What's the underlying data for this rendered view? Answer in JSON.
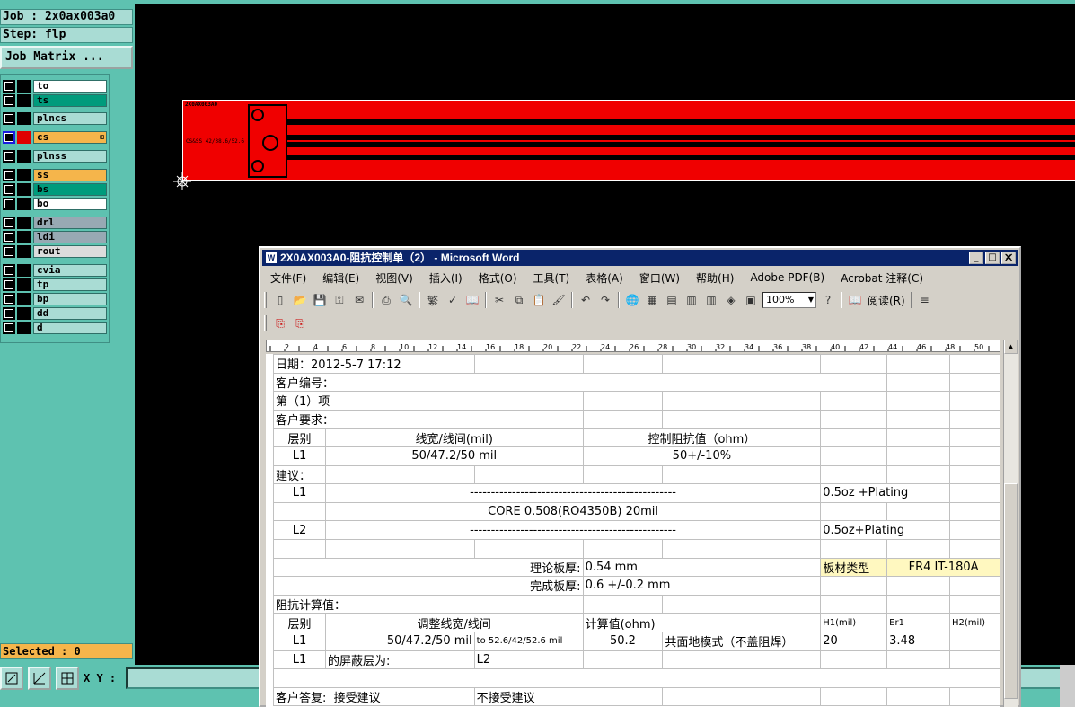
{
  "cam": {
    "job_line": "Job : 2x0ax003a0",
    "step_line": "Step: flp",
    "job_matrix_label": "Job Matrix ...",
    "selected_line": "Selected : 0",
    "xy_label": "X Y :",
    "xy_value": "",
    "layers": [
      {
        "name": "to",
        "color": "#ffffff"
      },
      {
        "name": "ts",
        "color": "#009b7c"
      },
      {
        "name": "plncs",
        "color": "#a9dcd4"
      },
      {
        "name": "cs",
        "color": "#f5b54b",
        "active": true
      },
      {
        "name": "plnss",
        "color": "#a9dcd4"
      },
      {
        "name": "ss",
        "color": "#f5b54b"
      },
      {
        "name": "bs",
        "color": "#009b7c"
      },
      {
        "name": "bo",
        "color": "#ffffff"
      },
      {
        "name": "drl",
        "color": "#97a9b3"
      },
      {
        "name": "ldi",
        "color": "#97a9b3"
      },
      {
        "name": "rout",
        "color": "#dcdcdc"
      },
      {
        "name": "cvia",
        "color": "#a9dcd4"
      },
      {
        "name": "tp",
        "color": "#a9dcd4"
      },
      {
        "name": "bp",
        "color": "#a9dcd4"
      },
      {
        "name": "dd",
        "color": "#a9dcd4"
      },
      {
        "name": "d",
        "color": "#a9dcd4"
      }
    ],
    "board_label_top": "2X0AX003A0",
    "board_label_side": "CS&SS 42/38.6/52.6",
    "tools": [
      "zoom-area-icon",
      "measure-icon",
      "snap-grid-icon"
    ]
  },
  "word": {
    "title": "2X0AX003A0-阻抗控制单（2） - Microsoft Word",
    "menus": [
      "文件(F)",
      "编辑(E)",
      "视图(V)",
      "插入(I)",
      "格式(O)",
      "工具(T)",
      "表格(A)",
      "窗口(W)",
      "帮助(H)",
      "Adobe PDF(B)",
      "Acrobat 注释(C)"
    ],
    "zoom": "100%",
    "read_label": "阅读(R)",
    "ruler": "2  4  6  8  10  12  14  16  18  20  22  24  26  28  30  32  34  36  38  40  42  44  46  48  50",
    "doc": {
      "date_label": "日期：",
      "date_value": "2012-5-7 17:12",
      "customer_no_label": "客户编号：",
      "item_label": "第（1）项",
      "customer_req_label": "客户要求：",
      "hdr_layer": "层别",
      "hdr_width": "线宽/线间(mil)",
      "hdr_impedance": "控制阻抗值（ohm）",
      "req_layer": "L1",
      "req_width": "50/47.2/50 mil",
      "req_impedance": "50+/-10%",
      "suggest_label": "建议：",
      "stack_l1": "L1",
      "stack_line1": "-------------------------------------------------",
      "stack_cu1": "0.5oz +Plating",
      "stack_core": "CORE  0.508(RO4350B)  20mil",
      "stack_l2": "L2",
      "stack_line2": "-------------------------------------------------",
      "stack_cu2": "0.5oz+Plating",
      "theory_label": "理论板厚:",
      "theory_value": "0.54 mm",
      "material_label": "板材类型",
      "material_value": "FR4 IT-180A",
      "finish_label": "完成板厚:",
      "finish_value": "0.6 +/-0.2 mm",
      "calc_label": "阻抗计算值：",
      "calc_hdr_layer": "层别",
      "calc_hdr_width": "调整线宽/线间",
      "calc_hdr_value": "计算值(ohm)",
      "calc_hdr_h1": "H1(mil)",
      "calc_hdr_er": "Er1",
      "calc_hdr_h2": "H2(mil)",
      "calc_layer": "L1",
      "calc_width_a": "50/47.2/50 mil",
      "calc_width_b": "to 52.6/42/52.6 mil",
      "calc_value": "50.2",
      "calc_model": "共面地模式（不盖阻焊）",
      "calc_h1": "20",
      "calc_er": "3.48",
      "shield_layer": "L1",
      "shield_label": "的屏蔽层为:",
      "shield_value": "L2",
      "reply_label": "客户答复:",
      "reply_accept": "接受建议",
      "reply_reject": "不接受建议"
    }
  }
}
